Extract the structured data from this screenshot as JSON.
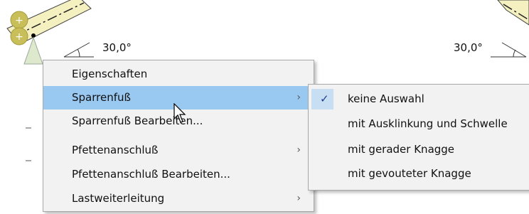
{
  "drawing": {
    "angle_left": "30,0°",
    "angle_right": "30,0°"
  },
  "context_menu": {
    "items": [
      {
        "label": "Eigenschaften",
        "has_submenu": false
      },
      {
        "label": "Sparrenfuß",
        "has_submenu": true,
        "highlighted": true
      },
      {
        "label": "Sparrenfuß Bearbeiten...",
        "has_submenu": false
      },
      {
        "label": "Pfettenanschluß",
        "has_submenu": true
      },
      {
        "label": "Pfettenanschluß Bearbeiten...",
        "has_submenu": false
      },
      {
        "label": "Lastweiterleitung",
        "has_submenu": true
      }
    ],
    "submenu_arrow": "›"
  },
  "submenu": {
    "items": [
      {
        "label": "keine Auswahl",
        "checked": true
      },
      {
        "label": "mit Ausklinkung und Schwelle",
        "checked": false
      },
      {
        "label": "mit gerader Knagge",
        "checked": false
      },
      {
        "label": "mit gevouteter Knagge",
        "checked": false
      }
    ],
    "check_glyph": "✓"
  },
  "colors": {
    "highlight": "#99c9f0",
    "menu_bg": "#f2f2f2",
    "beam_fill": "#f4f0c0",
    "node_fill": "#c8bf5a"
  }
}
